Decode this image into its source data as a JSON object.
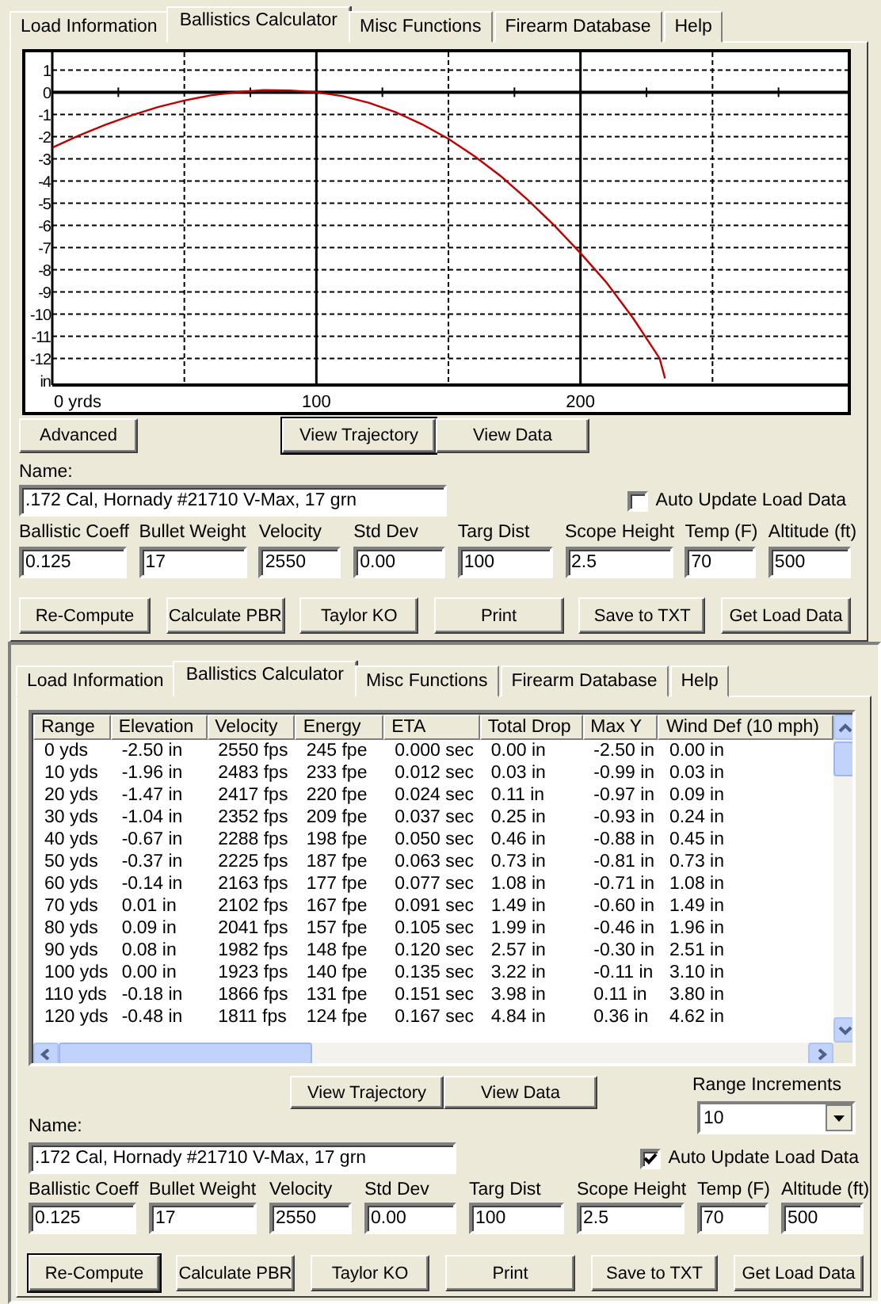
{
  "panels": [
    {
      "kind": "chart",
      "tabs": [
        {
          "label": "Load Information",
          "selected": false
        },
        {
          "label": "Ballistics Calculator",
          "selected": true
        },
        {
          "label": "Misc Functions",
          "selected": false
        },
        {
          "label": "Firearm Database",
          "selected": false
        },
        {
          "label": "Help",
          "selected": false
        }
      ],
      "chart_data": {
        "type": "line",
        "x": [
          0,
          10,
          20,
          30,
          40,
          50,
          60,
          70,
          80,
          90,
          100,
          110,
          120,
          130,
          140,
          150,
          160,
          170,
          180,
          190,
          200,
          210,
          220,
          230,
          232
        ],
        "xlim": [
          0,
          300
        ],
        "ylim": [
          -13.2,
          1.8
        ],
        "xticks": [
          {
            "value": 0,
            "label": "0 yrds"
          },
          100,
          200
        ],
        "yticks": [
          1,
          0,
          -1,
          -2,
          -3,
          -4,
          -5,
          -6,
          -7,
          -8,
          -9,
          -10,
          -11,
          -12,
          {
            "value": -13,
            "label": "in"
          }
        ],
        "grid": true,
        "series": [
          {
            "color": "#c00000",
            "values": [
              -2.5,
              -1.96,
              -1.47,
              -1.04,
              -0.67,
              -0.37,
              -0.14,
              0.01,
              0.09,
              0.08,
              0,
              -0.18,
              -0.48,
              -0.9,
              -1.44,
              -2.1,
              -2.9,
              -3.8,
              -4.85,
              -6.0,
              -7.25,
              -8.6,
              -10.2,
              -12.0,
              -12.9
            ]
          }
        ]
      },
      "advanced_button": {
        "label": "Advanced"
      },
      "view_buttons": [
        {
          "label": "View Trajectory",
          "focused": true
        },
        {
          "label": "View Data",
          "focused": false
        }
      ],
      "name_label": "Name:",
      "name_value": ".172 Cal, Hornady #21710 V-Max, 17 grn",
      "auto_update": {
        "label": "Auto Update Load Data",
        "checked": false
      },
      "fields": [
        {
          "label": "Ballistic Coeff",
          "value": "0.125"
        },
        {
          "label": "Bullet Weight",
          "value": "17"
        },
        {
          "label": "Velocity",
          "value": "2550"
        },
        {
          "label": "Std Dev",
          "value": "0.00"
        },
        {
          "label": "Targ Dist",
          "value": "100"
        },
        {
          "label": "Scope Height",
          "value": "2.5"
        },
        {
          "label": "Temp (F)",
          "value": "70"
        },
        {
          "label": "Altitude (ft)",
          "value": "500"
        }
      ],
      "buttons": [
        {
          "label": "Re-Compute",
          "focused": false
        },
        {
          "label": "Calculate PBR",
          "focused": false
        },
        {
          "label": "Taylor KO",
          "focused": false
        },
        {
          "label": "Print",
          "focused": false
        },
        {
          "label": "Save to TXT",
          "focused": false
        },
        {
          "label": "Get Load Data",
          "focused": false
        }
      ]
    },
    {
      "kind": "table",
      "tabs": [
        {
          "label": "Load Information",
          "selected": false
        },
        {
          "label": "Ballistics Calculator",
          "selected": true
        },
        {
          "label": "Misc Functions",
          "selected": false
        },
        {
          "label": "Firearm Database",
          "selected": false
        },
        {
          "label": "Help",
          "selected": false
        }
      ],
      "table": {
        "columns": [
          "Range",
          "Elevation",
          "Velocity",
          "Energy",
          "ETA",
          "Total Drop",
          "Max Y",
          "Wind Def (10 mph)"
        ],
        "rows": [
          [
            "0 yds",
            "-2.50 in",
            "2550 fps",
            "245 fpe",
            "0.000 sec",
            "0.00 in",
            "-2.50 in",
            "0.00 in"
          ],
          [
            "10 yds",
            "-1.96 in",
            "2483 fps",
            "233 fpe",
            "0.012 sec",
            "0.03 in",
            "-0.99 in",
            "0.03 in"
          ],
          [
            "20 yds",
            "-1.47 in",
            "2417 fps",
            "220 fpe",
            "0.024 sec",
            "0.11 in",
            "-0.97 in",
            "0.09 in"
          ],
          [
            "30 yds",
            "-1.04 in",
            "2352 fps",
            "209 fpe",
            "0.037 sec",
            "0.25 in",
            "-0.93 in",
            "0.24 in"
          ],
          [
            "40 yds",
            "-0.67 in",
            "2288 fps",
            "198 fpe",
            "0.050 sec",
            "0.46 in",
            "-0.88 in",
            "0.45 in"
          ],
          [
            "50 yds",
            "-0.37 in",
            "2225 fps",
            "187 fpe",
            "0.063 sec",
            "0.73 in",
            "-0.81 in",
            "0.73 in"
          ],
          [
            "60 yds",
            "-0.14 in",
            "2163 fps",
            "177 fpe",
            "0.077 sec",
            "1.08 in",
            "-0.71 in",
            "1.08 in"
          ],
          [
            "70 yds",
            "0.01 in",
            "2102 fps",
            "167 fpe",
            "0.091 sec",
            "1.49 in",
            "-0.60 in",
            "1.49 in"
          ],
          [
            "80 yds",
            "0.09 in",
            "2041 fps",
            "157 fpe",
            "0.105 sec",
            "1.99 in",
            "-0.46 in",
            "1.96 in"
          ],
          [
            "90 yds",
            "0.08 in",
            "1982 fps",
            "148 fpe",
            "0.120 sec",
            "2.57 in",
            "-0.30 in",
            "2.51 in"
          ],
          [
            "100 yds",
            "0.00 in",
            "1923 fps",
            "140 fpe",
            "0.135 sec",
            "3.22 in",
            "-0.11 in",
            "3.10 in"
          ],
          [
            "110 yds",
            "-0.18 in",
            "1866 fps",
            "131 fpe",
            "0.151 sec",
            "3.98 in",
            "0.11 in",
            "3.80 in"
          ],
          [
            "120 yds",
            "-0.48 in",
            "1811 fps",
            "124 fpe",
            "0.167 sec",
            "4.84 in",
            "0.36 in",
            "4.62 in"
          ]
        ]
      },
      "view_buttons": [
        {
          "label": "View Trajectory",
          "focused": false
        },
        {
          "label": "View Data",
          "focused": false
        }
      ],
      "range_increments": {
        "label": "Range Increments",
        "value": "10"
      },
      "name_label": "Name:",
      "name_value": ".172 Cal, Hornady #21710 V-Max, 17 grn",
      "auto_update": {
        "label": "Auto Update Load Data",
        "checked": true
      },
      "fields": [
        {
          "label": "Ballistic Coeff",
          "value": "0.125"
        },
        {
          "label": "Bullet Weight",
          "value": "17"
        },
        {
          "label": "Velocity",
          "value": "2550"
        },
        {
          "label": "Std Dev",
          "value": "0.00"
        },
        {
          "label": "Targ Dist",
          "value": "100"
        },
        {
          "label": "Scope Height",
          "value": "2.5"
        },
        {
          "label": "Temp (F)",
          "value": "70"
        },
        {
          "label": "Altitude (ft)",
          "value": "500"
        }
      ],
      "buttons": [
        {
          "label": "Re-Compute",
          "focused": true
        },
        {
          "label": "Calculate PBR",
          "focused": false
        },
        {
          "label": "Taylor KO",
          "focused": false
        },
        {
          "label": "Print",
          "focused": false
        },
        {
          "label": "Save to TXT",
          "focused": false
        },
        {
          "label": "Get Load Data",
          "focused": false
        }
      ]
    }
  ]
}
